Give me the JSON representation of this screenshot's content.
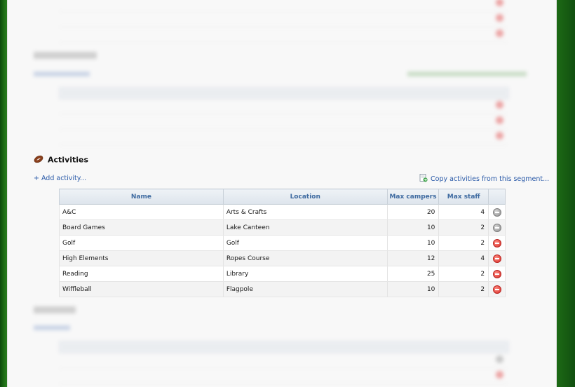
{
  "activities_section": {
    "title": "Activities",
    "add_link": "+ Add activity...",
    "copy_link": "Copy activities from this segment...",
    "columns": [
      "Name",
      "Location",
      "Max campers",
      "Max staff"
    ],
    "rows": [
      {
        "name": "A&C",
        "location": "Arts & Crafts",
        "max_campers": "20",
        "max_staff": "4",
        "remove_state": "inactive"
      },
      {
        "name": "Board Games",
        "location": "Lake Canteen",
        "max_campers": "10",
        "max_staff": "2",
        "remove_state": "inactive"
      },
      {
        "name": "Golf",
        "location": "Golf",
        "max_campers": "10",
        "max_staff": "2",
        "remove_state": "active"
      },
      {
        "name": "High Elements",
        "location": "Ropes Course",
        "max_campers": "12",
        "max_staff": "4",
        "remove_state": "active"
      },
      {
        "name": "Reading",
        "location": "Library",
        "max_campers": "25",
        "max_staff": "2",
        "remove_state": "active"
      },
      {
        "name": "Wiffleball",
        "location": "Flagpole",
        "max_campers": "10",
        "max_staff": "2",
        "remove_state": "active"
      }
    ]
  },
  "icons": {
    "section_icon": "football-icon",
    "copy_icon": "copy-document-icon",
    "remove_icon": "remove-circle-icon"
  },
  "colors": {
    "link": "#2a5aa8",
    "header_text": "#3e6aa0",
    "remove_active": "#d9302a",
    "remove_inactive": "#8e8e8e",
    "side_background": "#1f6e16"
  }
}
